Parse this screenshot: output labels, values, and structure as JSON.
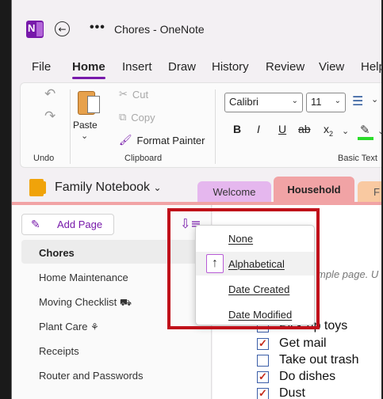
{
  "window": {
    "title_page": "Chores",
    "title_app": "OneNote",
    "logo_letter": "N"
  },
  "menu": {
    "tabs": [
      "File",
      "Home",
      "Insert",
      "Draw",
      "History",
      "Review",
      "View",
      "Help"
    ],
    "active": "Home"
  },
  "ribbon": {
    "groups": [
      "Undo",
      "Clipboard",
      "Basic Text"
    ],
    "paste_label": "Paste",
    "cut_label": "Cut",
    "copy_label": "Copy",
    "format_painter_label": "Format Painter",
    "font_name": "Calibri",
    "font_size": "11",
    "bold_label": "B",
    "italic_label": "I",
    "underline_label": "U",
    "strike_label": "ab",
    "subscript_label": "x",
    "subscript_small": "2"
  },
  "notebook": {
    "name": "Family Notebook",
    "sections": [
      {
        "label": "Welcome",
        "color": "#e5b7ee"
      },
      {
        "label": "Household",
        "color": "#f1a3a5"
      },
      {
        "label": "F",
        "color": "#f9c9a1"
      }
    ],
    "active_section": "Household"
  },
  "pages": {
    "add_page_label": "Add Page",
    "items": [
      "Chores",
      "Home Maintenance",
      "Moving Checklist",
      "Plant Care",
      "Receipts",
      "Router and Passwords"
    ],
    "selected": "Chores"
  },
  "sort_menu": {
    "options": [
      "None",
      "Alphabetical",
      "Date Created",
      "Date Modified"
    ],
    "checked": "Alphabetical"
  },
  "content": {
    "tagline": "mple page. U",
    "tasks": [
      {
        "text": "Pick up toys",
        "checked": false
      },
      {
        "text": "Get mail",
        "checked": true
      },
      {
        "text": "Take out trash",
        "checked": false
      },
      {
        "text": "Do dishes",
        "checked": true
      },
      {
        "text": "Dust",
        "checked": true
      }
    ]
  },
  "colors": {
    "accent": "#7719aa",
    "highlight_border": "#c0101a",
    "section_line": "#f1a3a5"
  }
}
